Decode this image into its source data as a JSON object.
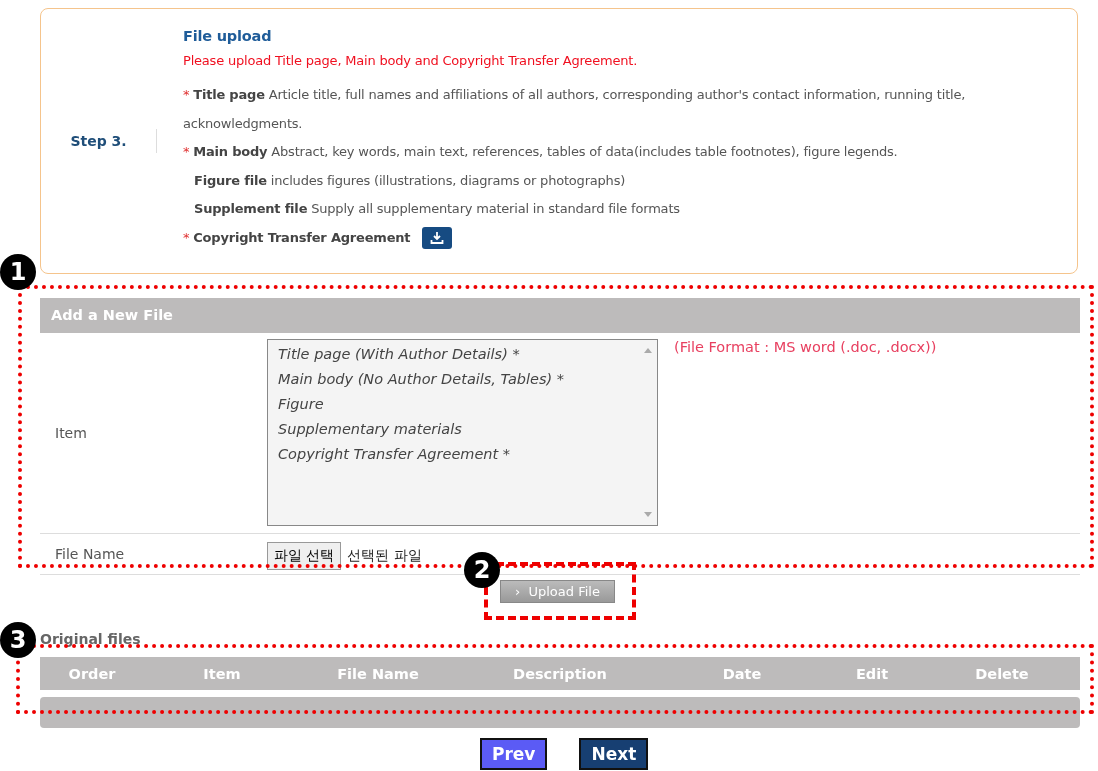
{
  "step": {
    "label": "Step 3.",
    "title": "File upload",
    "notice": "Please upload Title page, Main body and Copyright Transfer Agreement.",
    "requirements": [
      {
        "required": true,
        "name": "Title page",
        "text": "Article title, full names and affiliations of all authors, corresponding author's contact information, running title, acknowledgments."
      },
      {
        "required": true,
        "name": "Main body",
        "text": "Abstract, key words, main text, references, tables of data(includes table footnotes), figure legends."
      },
      {
        "required": false,
        "name": "Figure file",
        "text": "includes figures (illustrations, diagrams or photographs)"
      },
      {
        "required": false,
        "name": "Supplement file",
        "text": "Supply all supplementary material in standard file formats"
      },
      {
        "required": true,
        "name": "Copyright Transfer Agreement",
        "download": true
      }
    ],
    "required_mark": "*"
  },
  "new_file": {
    "title": "Add a New File",
    "item_label": "Item",
    "items": [
      "Title page (With Author Details) *",
      "Main body (No Author Details, Tables) *",
      "Figure",
      "Supplementary materials",
      "Copyright Transfer Agreement *"
    ],
    "format_note": "(File Format : MS word (.doc, .docx))",
    "file_label": "File Name",
    "choose_button": "파일 선택",
    "no_file": "선택된 파일"
  },
  "upload_button": {
    "icon": "›",
    "label": "Upload File"
  },
  "original_files": {
    "title": "Original files",
    "columns": [
      "Order",
      "Item",
      "File Name",
      "Description",
      "Date",
      "Edit",
      "Delete"
    ]
  },
  "nav": [
    {
      "label": "Prev",
      "kind": "prev"
    },
    {
      "label": "Next",
      "kind": "next"
    }
  ],
  "callouts": [
    "1",
    "2",
    "3"
  ]
}
